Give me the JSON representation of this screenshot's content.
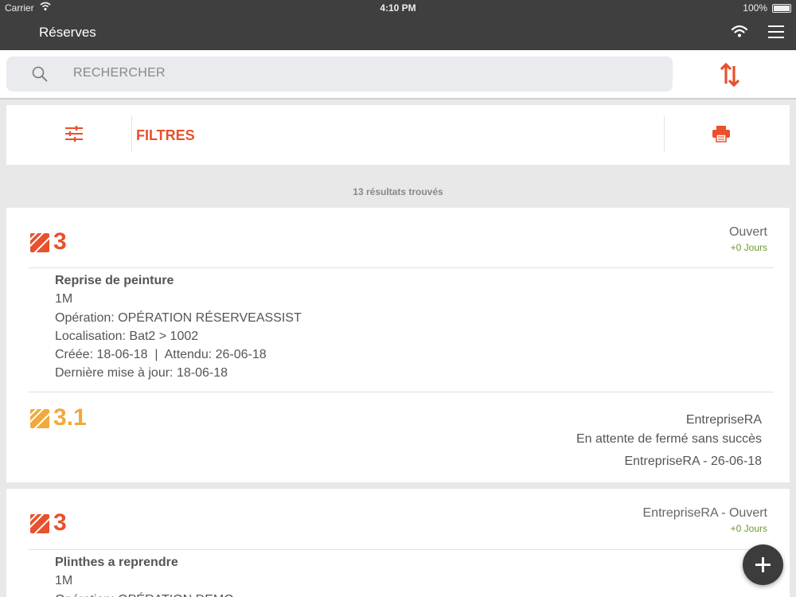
{
  "status_bar": {
    "carrier": "Carrier",
    "time": "4:10 PM",
    "battery": "100%"
  },
  "nav": {
    "title": "Réserves"
  },
  "search": {
    "placeholder": "RECHERCHER"
  },
  "filters": {
    "label": "FILTRES"
  },
  "results_text": "13 résultats trouvés",
  "colors": {
    "accent": "#e8512c",
    "sub_accent": "#f2a93b",
    "days_green": "#6a9a33",
    "nav_bg": "#3f3f3f"
  },
  "cards": [
    {
      "number": "3",
      "status": "Ouvert",
      "days": "+0 Jours",
      "title": "Reprise de peinture",
      "lines": [
        "1M",
        "Opération: OPÉRATION RÉSERVEASSIST",
        "Localisation: Bat2 > 1002",
        "Créée: 18-06-18  |  Attendu: 26-06-18",
        "Dernière mise à jour: 18-06-18"
      ],
      "sub": {
        "number": "3.1",
        "company": "EntrepriseRA",
        "status": "En attente de fermé sans succès",
        "footer": "EntrepriseRA - 26-06-18"
      }
    },
    {
      "number": "3",
      "status": "EntrepriseRA - Ouvert",
      "days": "+0 Jours",
      "title": "Plinthes a reprendre",
      "lines": [
        "1M",
        "Opération: OPÉRATION DEMO"
      ]
    }
  ]
}
